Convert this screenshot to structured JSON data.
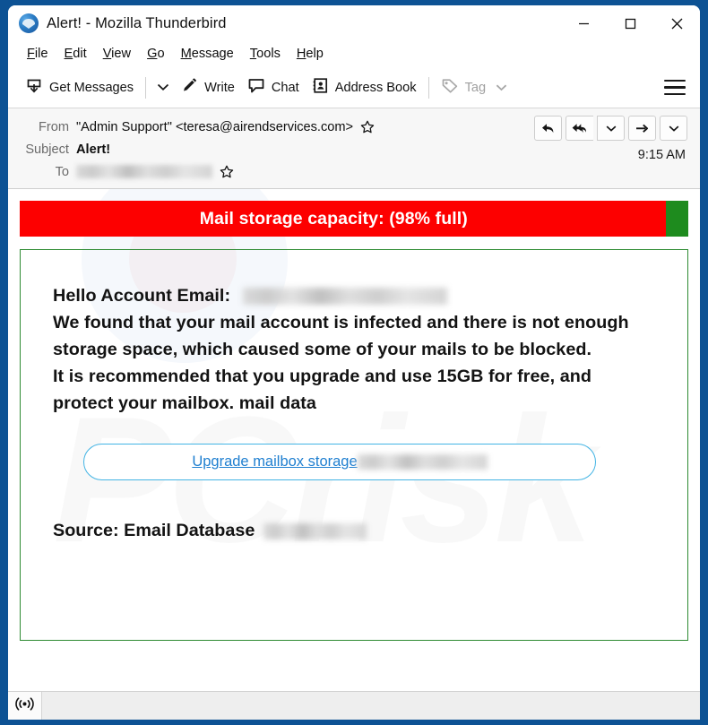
{
  "window": {
    "title": "Alert! - Mozilla Thunderbird",
    "logo_icon": "thunderbird-logo",
    "controls": {
      "minimize": "minimize-icon",
      "maximize": "maximize-icon",
      "close": "close-icon"
    }
  },
  "menubar": {
    "items": [
      {
        "label": "File",
        "accesskey": "F"
      },
      {
        "label": "Edit",
        "accesskey": "E"
      },
      {
        "label": "View",
        "accesskey": "V"
      },
      {
        "label": "Go",
        "accesskey": "G"
      },
      {
        "label": "Message",
        "accesskey": "M"
      },
      {
        "label": "Tools",
        "accesskey": "T"
      },
      {
        "label": "Help",
        "accesskey": "H"
      }
    ]
  },
  "toolbar": {
    "get_messages_label": "Get Messages",
    "get_messages_icon": "inbox-download-icon",
    "get_messages_caret_icon": "chevron-down-icon",
    "write_label": "Write",
    "write_icon": "pencil-icon",
    "chat_label": "Chat",
    "chat_icon": "speech-bubble-icon",
    "address_book_label": "Address Book",
    "address_book_icon": "address-book-icon",
    "tag_label": "Tag",
    "tag_icon": "tag-icon",
    "tag_caret_icon": "chevron-down-icon",
    "app_menu_icon": "hamburger-menu-icon"
  },
  "message_header": {
    "from_label": "From",
    "from_value": "\"Admin Support\" <teresa@airendservices.com>",
    "from_star_icon": "star-icon",
    "subject_label": "Subject",
    "subject_value": "Alert!",
    "to_label": "To",
    "to_value_redacted": "",
    "to_star_icon": "star-icon",
    "timestamp": "9:15 AM",
    "actions": {
      "reply_icon": "reply-arrow-icon",
      "reply_all_icon": "reply-all-arrow-icon",
      "reply_more_icon": "chevron-down-icon",
      "forward_icon": "forward-arrow-icon",
      "more_icon": "chevron-down-icon"
    }
  },
  "message_body": {
    "banner": {
      "text": "Mail storage capacity: (98% full)",
      "percent_full": 98,
      "fill_color": "#fd0000",
      "remaining_color": "#1e8b1e"
    },
    "greeting_prefix": "Hello Account Email:",
    "greeting_redacted": "",
    "paragraph_1": "We found that your mail account is infected and there is not enough storage space, which caused some of your mails to be blocked.",
    "paragraph_2": "It is recommended that you upgrade and use 15GB for free, and protect your mailbox.  mail data",
    "cta_label": "Upgrade mailbox storage",
    "cta_redacted": "",
    "source_label": "Source: Email Database",
    "source_redacted": "",
    "border_color": "#2e8b32",
    "cta_border_color": "#43b4e4",
    "cta_link_color": "#1f7fd0"
  },
  "statusbar": {
    "connection_icon": "broadcast-signal-icon"
  }
}
